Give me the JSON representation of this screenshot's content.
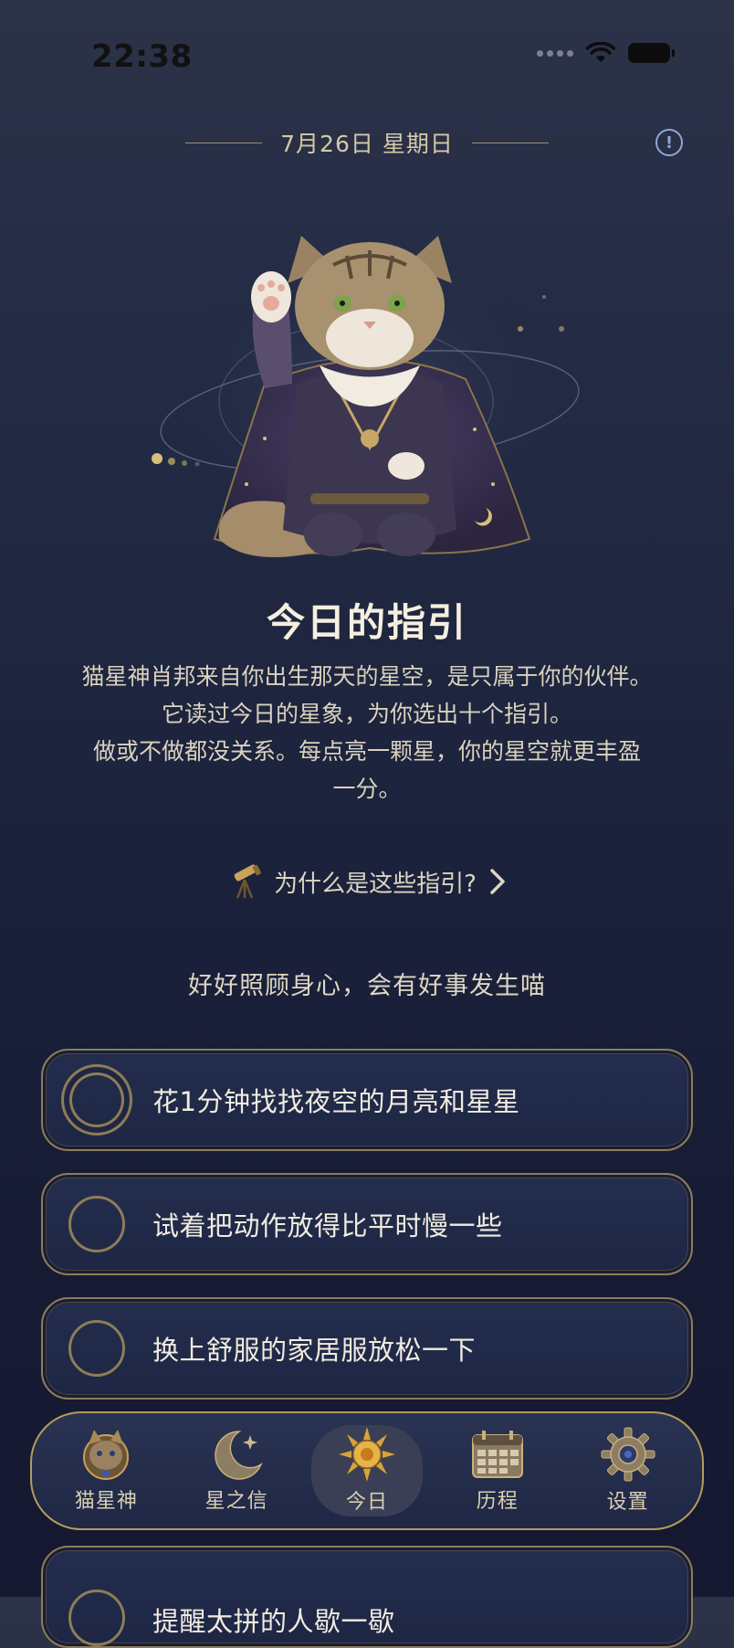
{
  "status_bar": {
    "time": "22:38",
    "icons": [
      "signal-dots-icon",
      "wifi-icon",
      "battery-icon"
    ]
  },
  "header": {
    "date": "7月26日 星期日",
    "info_icon": "info-icon"
  },
  "hero": {
    "image": "wizard-cat-illustration"
  },
  "guidance": {
    "title": "今日的指引",
    "intro_lines": [
      "猫星神肖邦来自你出生那天的星空，是只属于你的伙伴。",
      "它读过今日的星象，为你选出十个指引。",
      "做或不做都没关系。每点亮一颗星，你的星空就更丰盈",
      "一分。"
    ],
    "why_link": "为什么是这些指引?",
    "slogan": "好好照顾身心，会有好事发生喵"
  },
  "tasks": [
    {
      "text": "花1分钟找找夜空的月亮和星星"
    },
    {
      "text": "试着把动作放得比平时慢一些"
    },
    {
      "text": "换上舒服的家居服放松一下"
    },
    {
      "text": "提醒太拼的人歇一歇"
    }
  ],
  "tabbar": {
    "tabs": [
      {
        "label": "猫星神",
        "icon": "cat-emblem-icon"
      },
      {
        "label": "星之信",
        "icon": "crescent-moon-icon"
      },
      {
        "label": "今日",
        "icon": "sun-icon",
        "active": true
      },
      {
        "label": "历程",
        "icon": "calendar-icon"
      },
      {
        "label": "设置",
        "icon": "gear-icon"
      }
    ]
  },
  "colors": {
    "accent_gold": "#b59b5d",
    "background_top": "#2c3348",
    "background_bottom": "#141830",
    "card_bg": "#222b4a"
  }
}
